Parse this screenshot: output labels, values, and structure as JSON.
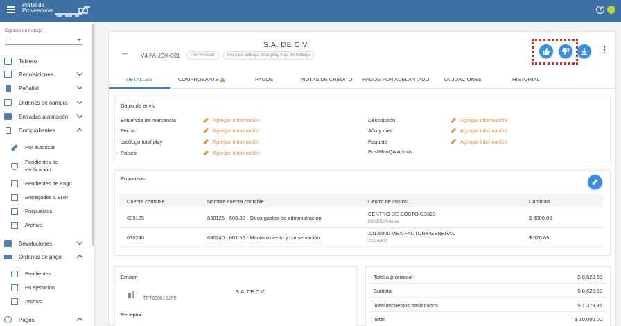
{
  "app": {
    "title_line1": "Portal de",
    "title_line2": "Proveedores"
  },
  "sidebar": {
    "workspace_label": "Espacio de trabajo",
    "items": [
      {
        "label": "Tablero",
        "icon": "dashboard-icon"
      },
      {
        "label": "Requisiciones",
        "icon": "requisitions-icon"
      },
      {
        "label": "Peñafiel",
        "icon": "bottle-icon"
      },
      {
        "label": "Órdenes de compra",
        "icon": "purchase-orders-icon"
      },
      {
        "label": "Entradas a almacén",
        "icon": "warehouse-truck-icon"
      },
      {
        "label": "Comprobantes",
        "icon": "document-icon"
      },
      {
        "label": "Devoluciones",
        "icon": "returns-icon"
      },
      {
        "label": "Órdenes de pago",
        "icon": "payment-orders-icon"
      },
      {
        "label": "Pagos",
        "icon": "payments-icon"
      }
    ],
    "comprobantes_sub": [
      {
        "label": "Por autorizar",
        "icon": "gavel-icon"
      },
      {
        "label": "Pendientes de",
        "label2": "verificación",
        "icon": "shield-icon"
      },
      {
        "label": "Pendientes de Pago",
        "icon": "chart-icon"
      },
      {
        "label": "Entregados a ERP",
        "icon": "checklist-icon"
      },
      {
        "label": "Pospuestos",
        "icon": "clock-icon"
      },
      {
        "label": "Archivo",
        "icon": "archive-icon"
      }
    ],
    "pago_sub": [
      {
        "label": "Pendientes",
        "icon": "chart-icon"
      },
      {
        "label": "En ejecución",
        "icon": "checklist-icon"
      },
      {
        "label": "Archivo",
        "icon": "archive-icon"
      }
    ]
  },
  "header": {
    "title": "S.A. DE C.V.",
    "doc_id": "V4 PA-JOK-001",
    "status_chip": "Por verificar",
    "workflow_chip": "Flujo de trabajo: total play flujo de trabajo"
  },
  "tabs": [
    "DETALLES",
    "COMPROBANTE",
    "PAGOS",
    "NOTAS DE CRÉDITO",
    "PAGOS POR ADELANTADO",
    "VALIDACIONES",
    "HISTORIAL"
  ],
  "datos_envio": {
    "title": "Datos de envío",
    "add_label": "Agregar información",
    "left": [
      "Evidencia de mercancía",
      "Fecha",
      "catálogo total play",
      "Países"
    ],
    "right": [
      "Descripción",
      "Año y mes",
      "Paquete",
      "PostManQA Admin"
    ]
  },
  "prorrateos": {
    "title": "Prorrateos",
    "columns": [
      "Cuenta contable",
      "Nombre cuenta contable",
      "Centro de costos",
      "Cantidad"
    ],
    "rows": [
      {
        "cuenta": "630125",
        "nombre": "630125 - 603.82 - Otros gastos de administración",
        "centro": "CENTRO DE COSTO G3323",
        "centro_sub": "03030GPrueba",
        "cantidad": "$ 8000.00"
      },
      {
        "cuenta": "630240",
        "nombre": "630240 - 601.56 - Mantenimiento y conservación",
        "centro": "201-6000 MEX-FACTORY-GENERAL",
        "centro_sub": "201-6000",
        "cantidad": "$ 620.69"
      }
    ]
  },
  "emisor": {
    "title": "Emisor",
    "name": "S.A. DE C.V.",
    "rfc": "TPT890516JP5",
    "receptor_title": "Receptor"
  },
  "totales": [
    {
      "label": "Total a prorratear",
      "value": "$ 8,620.69"
    },
    {
      "label": "Subtotal",
      "value": "$ 8,620.69"
    },
    {
      "label": "Total impuestos trasladados",
      "value": "$ 1,379.31"
    },
    {
      "label": "Total",
      "value": "$ 10,000.00"
    }
  ],
  "colors": {
    "topbar": "#3d6fa3",
    "accent": "#3a7cc6",
    "action_button": "#3b8fe0",
    "add_link": "#e8923a",
    "highlight_box": "#d9261c"
  }
}
